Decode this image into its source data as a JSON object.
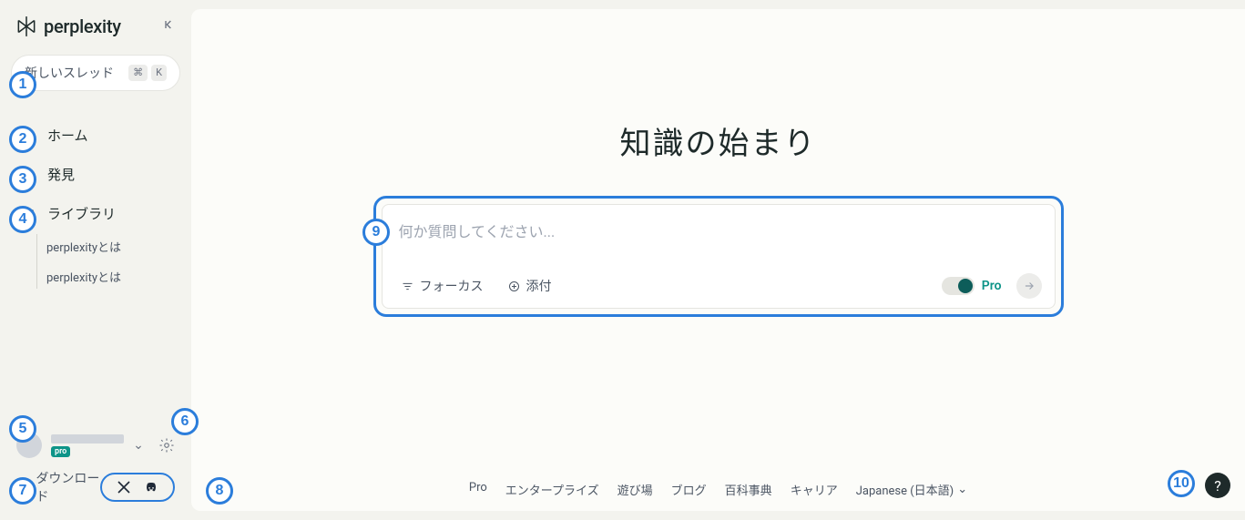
{
  "brand": "perplexity",
  "sidebar": {
    "new_thread_label": "新しいスレッド",
    "shortcut_cmd": "⌘",
    "shortcut_key": "K",
    "nav": {
      "home": "ホーム",
      "discover": "発見",
      "library": "ライブラリ"
    },
    "threads": [
      "perplexityとは",
      "perplexityとは"
    ],
    "pro_badge": "pro",
    "download": "ダウンロード"
  },
  "main": {
    "hero_title": "知識の始まり",
    "search_placeholder": "何か質問してください...",
    "focus_label": "フォーカス",
    "attach_label": "添付",
    "pro_label": "Pro"
  },
  "footer": {
    "links": [
      "Pro",
      "エンタープライズ",
      "遊び場",
      "ブログ",
      "百科事典",
      "キャリア"
    ],
    "language": "Japanese (日本語)"
  },
  "help": "?",
  "annotations": [
    "1",
    "2",
    "3",
    "4",
    "5",
    "6",
    "7",
    "8",
    "9",
    "10"
  ]
}
